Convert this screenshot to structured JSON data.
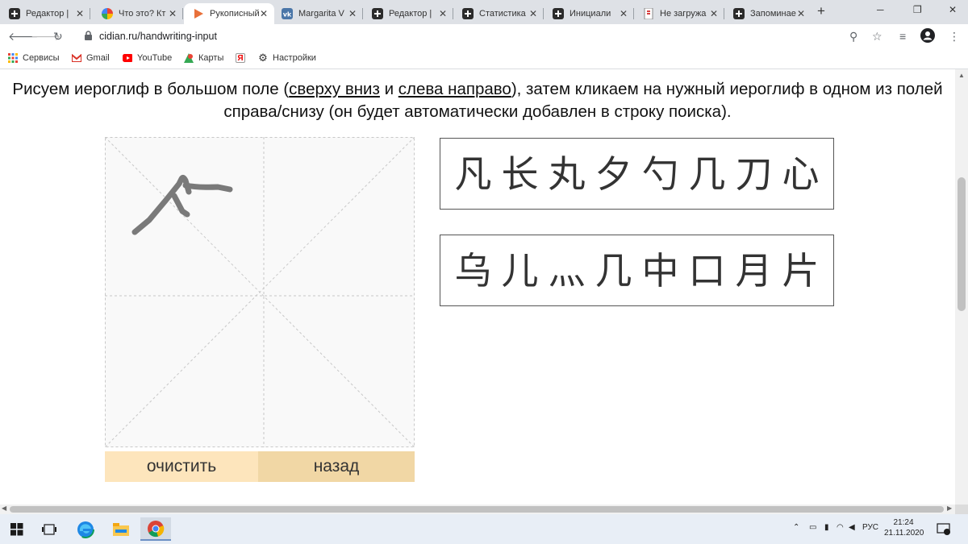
{
  "browser": {
    "tabs": [
      {
        "title": "Редактор |",
        "icon": "plus-square-icon"
      },
      {
        "title": "Что это? Кт",
        "icon": "pinwheel-icon"
      },
      {
        "title": "Рукописный",
        "icon": "play-icon",
        "active": true
      },
      {
        "title": "Margarita V",
        "icon": "vk-icon"
      },
      {
        "title": "Редактор |",
        "icon": "plus-square-icon"
      },
      {
        "title": "Статистика",
        "icon": "plus-square-icon"
      },
      {
        "title": "Инициали",
        "icon": "plus-square-icon"
      },
      {
        "title": "Не загружа",
        "icon": "page-error-icon"
      },
      {
        "title": "Запоминае",
        "icon": "plus-square-icon"
      }
    ],
    "new_tab": "+",
    "url": "cidian.ru/handwriting-input",
    "bookmarks": [
      {
        "label": "Сервисы",
        "icon": "apps-icon"
      },
      {
        "label": "Gmail",
        "icon": "gmail-icon"
      },
      {
        "label": "YouTube",
        "icon": "youtube-icon"
      },
      {
        "label": "Карты",
        "icon": "maps-icon"
      },
      {
        "label": "",
        "icon": "yandex-icon"
      },
      {
        "label": "Настройки",
        "icon": "settings-icon"
      }
    ]
  },
  "page": {
    "instruction_before": "Рисуем иероглиф в большом поле (",
    "link_top_down": "сверху вниз",
    "instruction_and": " и ",
    "link_left_right": "слева направо",
    "instruction_after": "), затем кликаем на нужный иероглиф в одном из полей справа/снизу (он будет автоматически добавлен в строку поиска).",
    "clear_button": "очистить",
    "back_button": "назад",
    "candidates_row1": [
      "凡",
      "长",
      "丸",
      "夕",
      "勺",
      "几",
      "刀",
      "心"
    ],
    "candidates_row2": [
      "乌",
      "儿",
      "灬",
      "几",
      "中",
      "口",
      "月",
      "片"
    ]
  },
  "taskbar": {
    "language": "РУС",
    "time": "21:24",
    "date": "21.11.2020",
    "notification_count": "1"
  },
  "colors": {
    "clear_button_bg": "#fde5bc",
    "back_button_bg": "#f1d7a5",
    "active_tab_icon": "#e8703a"
  }
}
